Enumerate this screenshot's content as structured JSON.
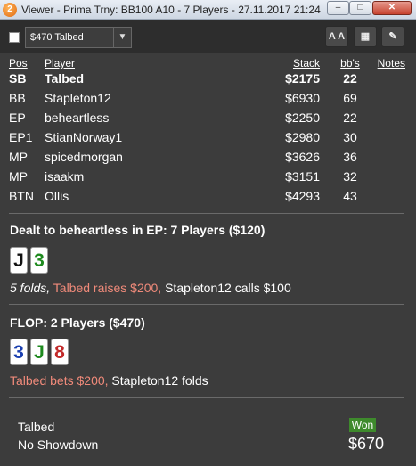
{
  "window": {
    "title": "Viewer - Prima Trny: BB100 A10 - 7 Players - 27.11.2017 21:24",
    "app_icon_glyph": "2",
    "min_glyph": "–",
    "max_glyph": "□",
    "close_glyph": "✕"
  },
  "toolbar": {
    "hand_select_value": "$470 Talbed",
    "dropdown_glyph": "▼",
    "font_button": "A A",
    "grid_button": "▦",
    "edit_button": "✎"
  },
  "table": {
    "headers": {
      "pos": "Pos",
      "player": "Player",
      "stack": "Stack",
      "bbs": "bb's",
      "notes": "Notes"
    },
    "rows": [
      {
        "pos": "SB",
        "player": "Talbed",
        "stack": "$2175",
        "bbs": "22",
        "hero": true
      },
      {
        "pos": "BB",
        "player": "Stapleton12",
        "stack": "$6930",
        "bbs": "69",
        "hero": false
      },
      {
        "pos": "EP",
        "player": "beheartless",
        "stack": "$2250",
        "bbs": "22",
        "hero": false
      },
      {
        "pos": "EP1",
        "player": "StianNorway1",
        "stack": "$2980",
        "bbs": "30",
        "hero": false
      },
      {
        "pos": "MP",
        "player": "spicedmorgan",
        "stack": "$3626",
        "bbs": "36",
        "hero": false
      },
      {
        "pos": "MP",
        "player": "isaakm",
        "stack": "$3151",
        "bbs": "32",
        "hero": false
      },
      {
        "pos": "BTN",
        "player": "Ollis",
        "stack": "$4293",
        "bbs": "43",
        "hero": false
      }
    ]
  },
  "preflop": {
    "title": "Dealt to beheartless in EP: 7 Players ($120)",
    "cards": [
      {
        "rank": "J",
        "color": "#111111"
      },
      {
        "rank": "3",
        "color": "#1e8a1e"
      }
    ],
    "actions": {
      "folds": "5 folds,",
      "hero": "Talbed raises $200,",
      "other": "Stapleton12 calls $100"
    }
  },
  "flop": {
    "title": "FLOP: 2 Players ($470)",
    "cards": [
      {
        "rank": "3",
        "color": "#1a3fb0"
      },
      {
        "rank": "J",
        "color": "#1e8a1e"
      },
      {
        "rank": "8",
        "color": "#c22a2a"
      }
    ],
    "actions": {
      "hero": "Talbed bets $200,",
      "other": "Stapleton12 folds"
    }
  },
  "result": {
    "winner": "Talbed",
    "showdown": "No Showdown",
    "badge": "Won",
    "amount": "$670"
  }
}
